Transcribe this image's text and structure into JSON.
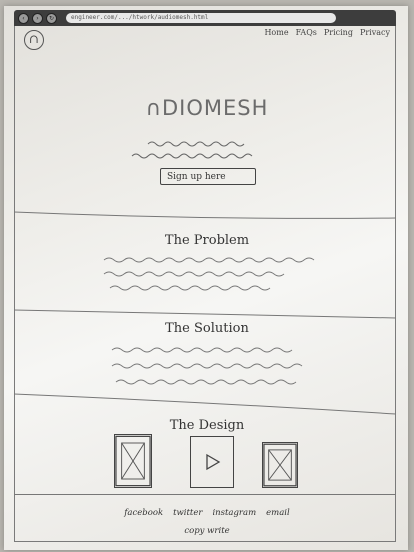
{
  "browser": {
    "url": "engineer.com/.../htwork/audiomesh.html"
  },
  "header": {
    "logo_letter": "∩",
    "nav": [
      "Home",
      "FAQs",
      "Pricing",
      "Privacy"
    ]
  },
  "hero": {
    "brand": "∩DIOMESH",
    "signup_label": "Sign up here"
  },
  "sections": {
    "problem_title": "The Problem",
    "solution_title": "The Solution",
    "design_title": "The Design"
  },
  "footer": {
    "links": [
      "facebook",
      "twitter",
      "instagram",
      "email"
    ],
    "copyright": "copy write"
  }
}
